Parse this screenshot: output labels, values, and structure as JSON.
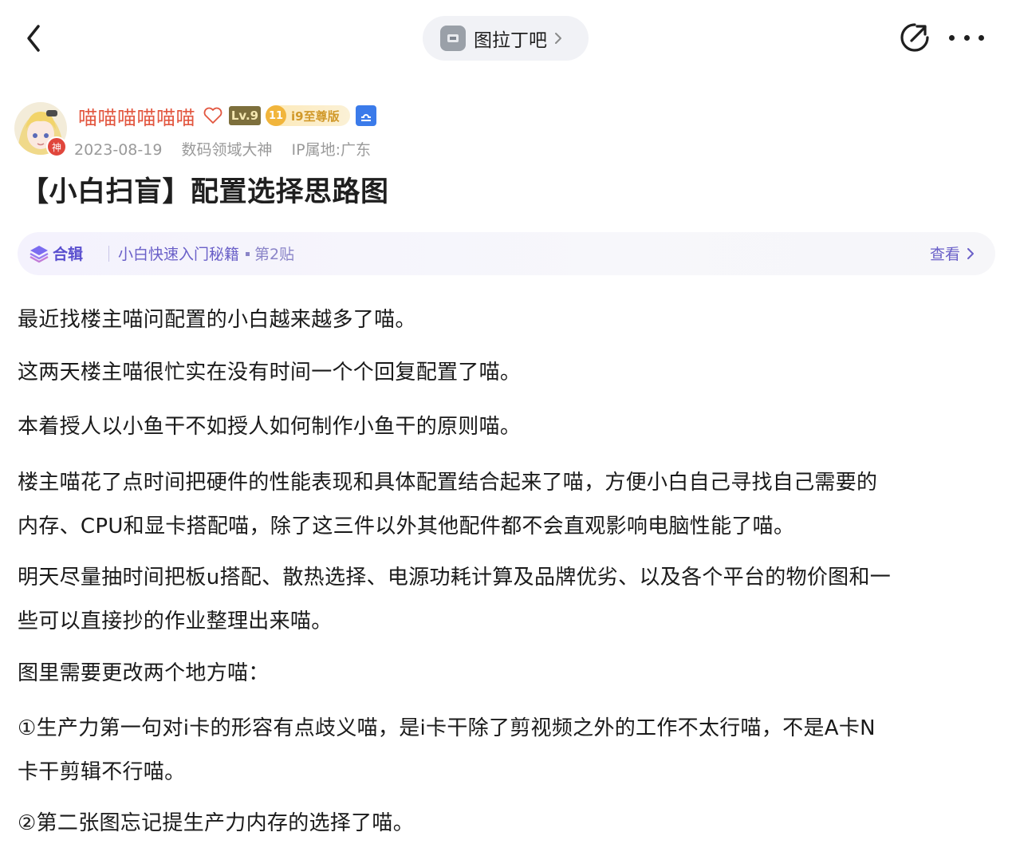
{
  "nav": {
    "forum_name": "图拉丁吧"
  },
  "author": {
    "name": "喵喵喵喵喵喵",
    "avatar_badge": "神",
    "level": "Lv.9",
    "vip_coin": "11",
    "vip_label": "i9至尊版",
    "date": "2023-08-19",
    "title": "数码领域大神",
    "ip_location": "IP属地:广东"
  },
  "post": {
    "title": "【小白扫盲】配置选择思路图"
  },
  "collection": {
    "label": "合辑",
    "name": "小白快速入门秘籍",
    "index": "第2贴",
    "view_label": "查看"
  },
  "body": {
    "lines": [
      "最近找楼主喵问配置的小白越来越多了喵。",
      "这两天楼主喵很忙实在没有时间一个个回复配置了喵。",
      "本着授人以小鱼干不如授人如何制作小鱼干的原则喵。",
      "楼主喵花了点时间把硬件的性能表现和具体配置结合起来了喵，方便小白自己寻找自己需要的",
      "内存、CPU和显卡搭配喵，除了这三件以外其他配件都不会直观影响电脑性能了喵。",
      "明天尽量抽时间把板u搭配、散热选择、电源功耗计算及品牌优劣、以及各个平台的物价图和一",
      "些可以直接抄的作业整理出来喵。",
      "图里需要更改两个地方喵：",
      "①生产力第一句对i卡的形容有点歧义喵，是i卡干除了剪视频之外的工作不太行喵，不是A卡N",
      "卡干剪辑不行喵。",
      "②第二张图忘记提生产力内存的选择了喵。"
    ]
  }
}
